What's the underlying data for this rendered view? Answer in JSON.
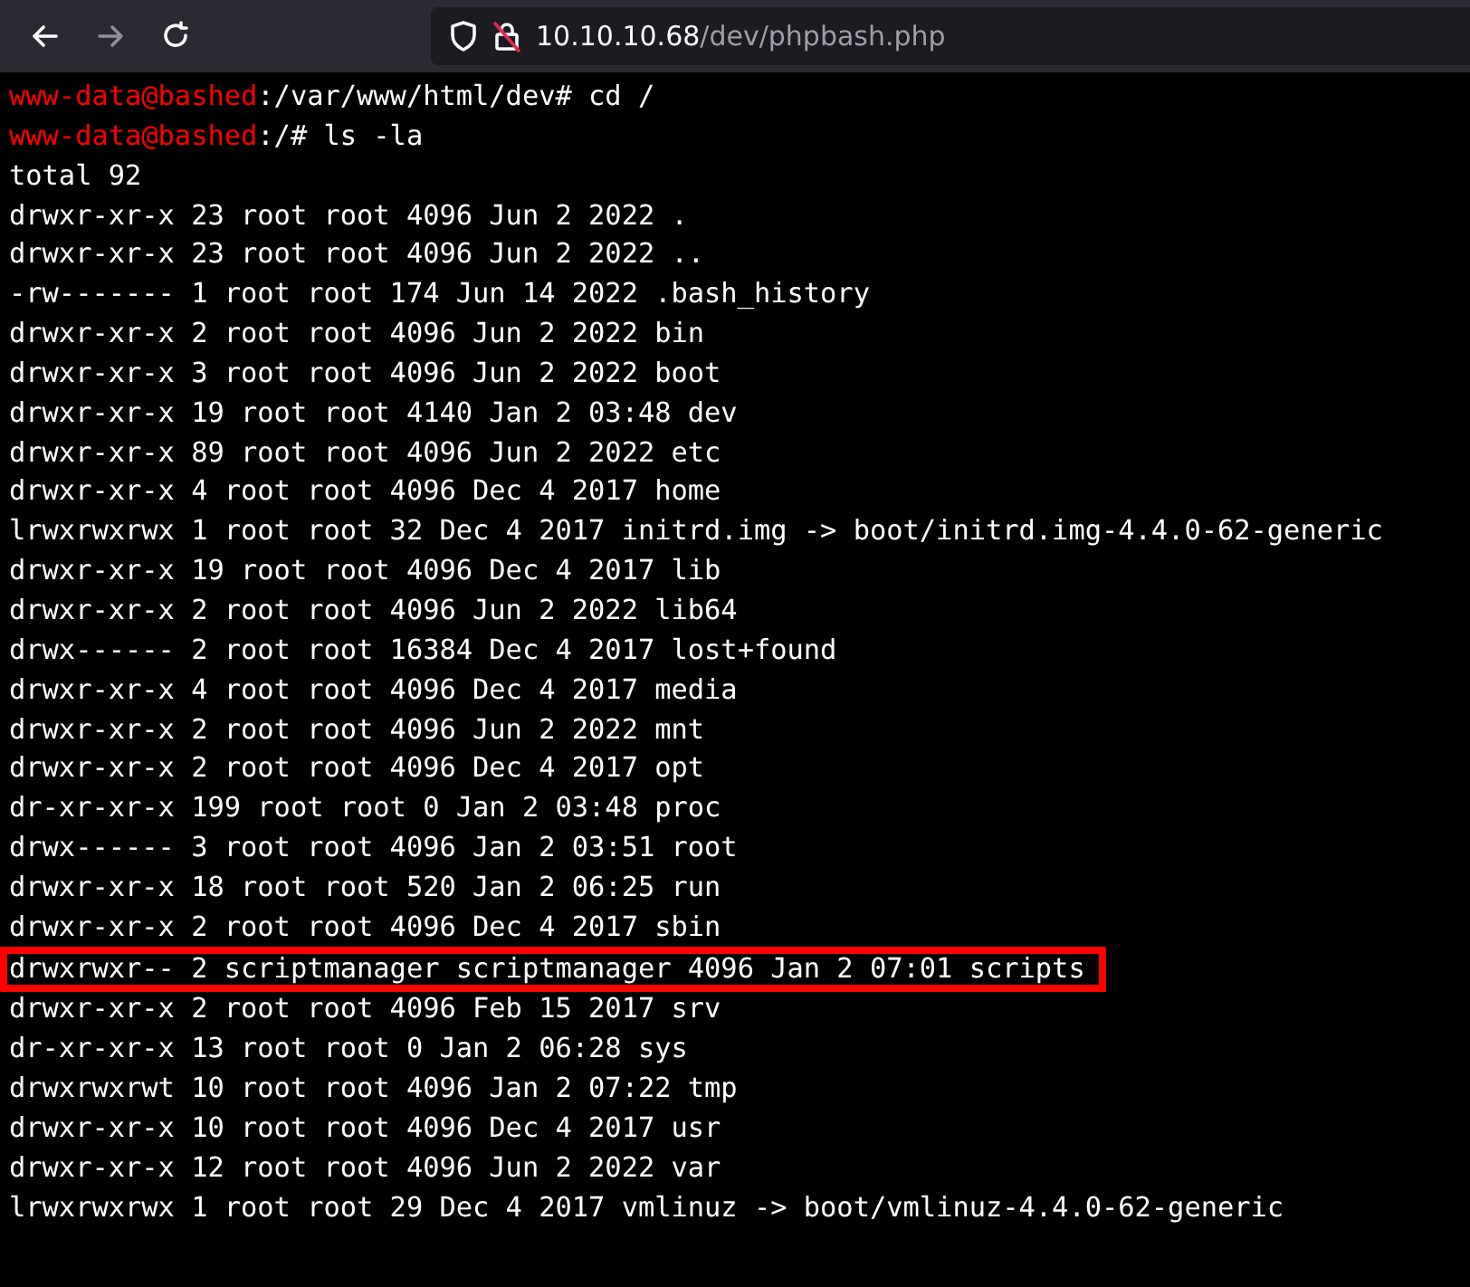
{
  "browser": {
    "url_host": "10.10.10.68",
    "url_path": "/dev/phpbash.php"
  },
  "terminal": {
    "lines": [
      {
        "kind": "prompt",
        "user": "www-data@bashed",
        "text": ":/var/www/html/dev# cd /"
      },
      {
        "kind": "prompt",
        "user": "www-data@bashed",
        "text": ":/# ls -la"
      },
      {
        "kind": "output",
        "text": "total 92",
        "highlighted": false
      },
      {
        "kind": "output",
        "text": "drwxr-xr-x 23 root root 4096 Jun 2 2022 .",
        "highlighted": false
      },
      {
        "kind": "output",
        "text": "drwxr-xr-x 23 root root 4096 Jun 2 2022 ..",
        "highlighted": false
      },
      {
        "kind": "output",
        "text": "-rw------- 1 root root 174 Jun 14 2022 .bash_history",
        "highlighted": false
      },
      {
        "kind": "output",
        "text": "drwxr-xr-x 2 root root 4096 Jun 2 2022 bin",
        "highlighted": false
      },
      {
        "kind": "output",
        "text": "drwxr-xr-x 3 root root 4096 Jun 2 2022 boot",
        "highlighted": false
      },
      {
        "kind": "output",
        "text": "drwxr-xr-x 19 root root 4140 Jan 2 03:48 dev",
        "highlighted": false
      },
      {
        "kind": "output",
        "text": "drwxr-xr-x 89 root root 4096 Jun 2 2022 etc",
        "highlighted": false
      },
      {
        "kind": "output",
        "text": "drwxr-xr-x 4 root root 4096 Dec 4 2017 home",
        "highlighted": false
      },
      {
        "kind": "output",
        "text": "lrwxrwxrwx 1 root root 32 Dec 4 2017 initrd.img -> boot/initrd.img-4.4.0-62-generic",
        "highlighted": false
      },
      {
        "kind": "output",
        "text": "drwxr-xr-x 19 root root 4096 Dec 4 2017 lib",
        "highlighted": false
      },
      {
        "kind": "output",
        "text": "drwxr-xr-x 2 root root 4096 Jun 2 2022 lib64",
        "highlighted": false
      },
      {
        "kind": "output",
        "text": "drwx------ 2 root root 16384 Dec 4 2017 lost+found",
        "highlighted": false
      },
      {
        "kind": "output",
        "text": "drwxr-xr-x 4 root root 4096 Dec 4 2017 media",
        "highlighted": false
      },
      {
        "kind": "output",
        "text": "drwxr-xr-x 2 root root 4096 Jun 2 2022 mnt",
        "highlighted": false
      },
      {
        "kind": "output",
        "text": "drwxr-xr-x 2 root root 4096 Dec 4 2017 opt",
        "highlighted": false
      },
      {
        "kind": "output",
        "text": "dr-xr-xr-x 199 root root 0 Jan 2 03:48 proc",
        "highlighted": false
      },
      {
        "kind": "output",
        "text": "drwx------ 3 root root 4096 Jan 2 03:51 root",
        "highlighted": false
      },
      {
        "kind": "output",
        "text": "drwxr-xr-x 18 root root 520 Jan 2 06:25 run",
        "highlighted": false
      },
      {
        "kind": "output",
        "text": "drwxr-xr-x 2 root root 4096 Dec 4 2017 sbin",
        "highlighted": false
      },
      {
        "kind": "output",
        "text": "drwxrwxr-- 2 scriptmanager scriptmanager 4096 Jan 2 07:01 scripts",
        "highlighted": true
      },
      {
        "kind": "output",
        "text": "drwxr-xr-x 2 root root 4096 Feb 15 2017 srv",
        "highlighted": false
      },
      {
        "kind": "output",
        "text": "dr-xr-xr-x 13 root root 0 Jan 2 06:28 sys",
        "highlighted": false
      },
      {
        "kind": "output",
        "text": "drwxrwxrwt 10 root root 4096 Jan 2 07:22 tmp",
        "highlighted": false
      },
      {
        "kind": "output",
        "text": "drwxr-xr-x 10 root root 4096 Dec 4 2017 usr",
        "highlighted": false
      },
      {
        "kind": "output",
        "text": "drwxr-xr-x 12 root root 4096 Jun 2 2022 var",
        "highlighted": false
      },
      {
        "kind": "output",
        "text": "lrwxrwxrwx 1 root root 29 Dec 4 2017 vmlinuz -> boot/vmlinuz-4.4.0-62-generic",
        "highlighted": false
      }
    ]
  }
}
